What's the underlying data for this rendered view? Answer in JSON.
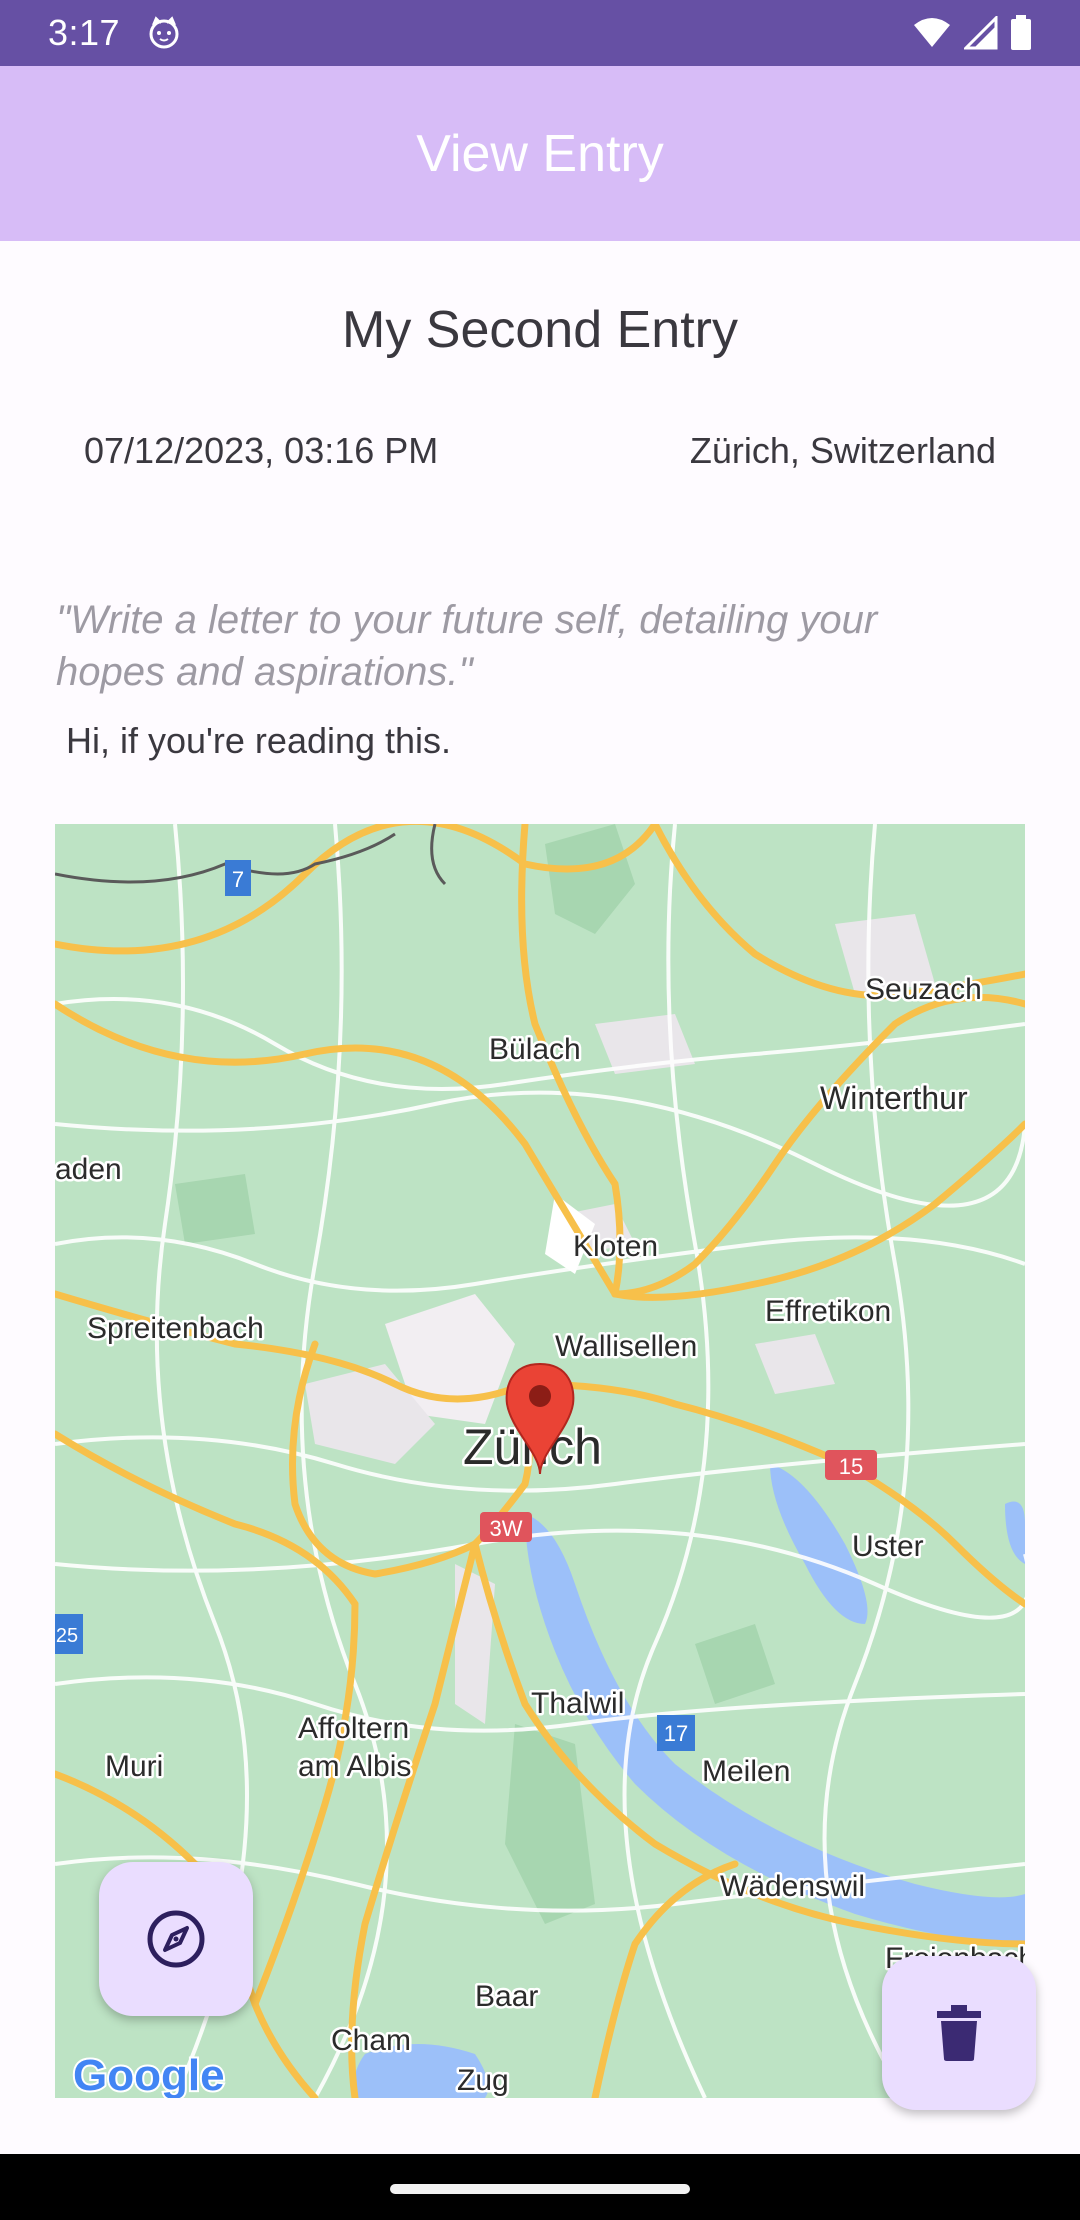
{
  "status_bar": {
    "time": "3:17"
  },
  "app_bar": {
    "title": "View Entry"
  },
  "entry": {
    "title": "My Second Entry",
    "datetime": "07/12/2023, 03:16 PM",
    "location": "Zürich, Switzerland",
    "prompt": "\"Write a letter to your future self, detailing your hopes and aspirations.\"",
    "body": "Hi, if you're reading this."
  },
  "map": {
    "places": {
      "seuzach": "Seuzach",
      "bulach": "Bülach",
      "winterthur": "Winterthur",
      "baden": "aden",
      "kloten": "Kloten",
      "spreitenbach": "Spreitenbach",
      "effretikon": "Effretikon",
      "wallisellen": "Wallisellen",
      "zurich": "Zürich",
      "uster": "Uster",
      "thalwil": "Thalwil",
      "affoltern1": "Affoltern",
      "affoltern2": "am Albis",
      "muri": "Muri",
      "meilen": "Meilen",
      "wadenswil": "Wädenswil",
      "baar": "Baar",
      "cham": "Cham",
      "zug": "Zug",
      "freienbach": "Freienbach"
    },
    "road_shields": {
      "a7": "7",
      "a15": "15",
      "a3w": "3W",
      "a25": "25",
      "a17": "17"
    },
    "attribution": "Google"
  },
  "icons": {
    "compass": "compass-icon",
    "delete": "trash-icon"
  },
  "colors": {
    "status_bar": "#6650a4",
    "app_bar": "#d7bcf7",
    "fab": "#eaddff",
    "fab_icon": "#2d1f5e",
    "pin": "#ea4335"
  }
}
